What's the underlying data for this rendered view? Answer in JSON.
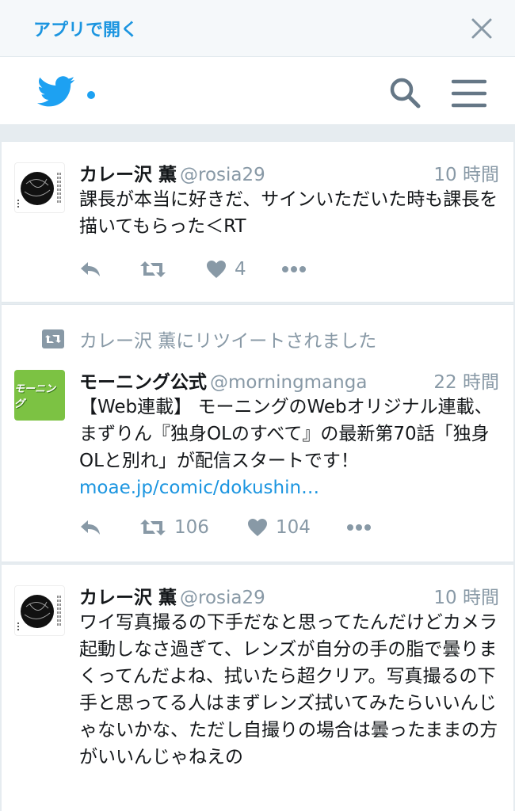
{
  "banner": {
    "open_app": "アプリで開く"
  },
  "colors": {
    "accent": "#1da1f2",
    "link": "#1b95e0",
    "muted": "#8899a6",
    "morning_green": "#7cc243"
  },
  "icons": {
    "close": "close-icon",
    "logo": "twitter-bird-icon",
    "search": "search-icon",
    "menu": "hamburger-menu-icon",
    "reply": "reply-icon",
    "retweet": "retweet-icon",
    "like": "heart-icon",
    "more": "more-dots-icon"
  },
  "tweets": [
    {
      "name": "カレー沢 薫",
      "handle": "@rosia29",
      "time": "10 時間",
      "text": "課長が本当に好きだ、サインいただいた時も課長を描いてもらった＜RT",
      "retweets": "",
      "likes": "4"
    },
    {
      "retweet_context": "カレー沢 薫にリツイートされました",
      "name": "モーニング公式",
      "handle": "@morningmanga",
      "time": "22 時間",
      "text": "【Web連載】 モーニングのWebオリジナル連載、まずりん『独身OLのすべて』の最新第70話「独身OLと別れ」が配信スタートです！ ",
      "link": "moae.jp/comic/dokushin…",
      "avatar_text": "モーニング",
      "retweets": "106",
      "likes": "104"
    },
    {
      "name": "カレー沢 薫",
      "handle": "@rosia29",
      "time": "10 時間",
      "text": "ワイ写真撮るの下手だなと思ってたんだけどカメラ起動しなさ過ぎて、レンズが自分の手の脂で曇りまくってんだよね、拭いたら超クリア。写真撮るの下手と思ってる人はまずレンズ拭いてみたらいいんじゃないかな、ただし自撮りの場合は曇ったままの方がいいんじゃねえの"
    }
  ]
}
